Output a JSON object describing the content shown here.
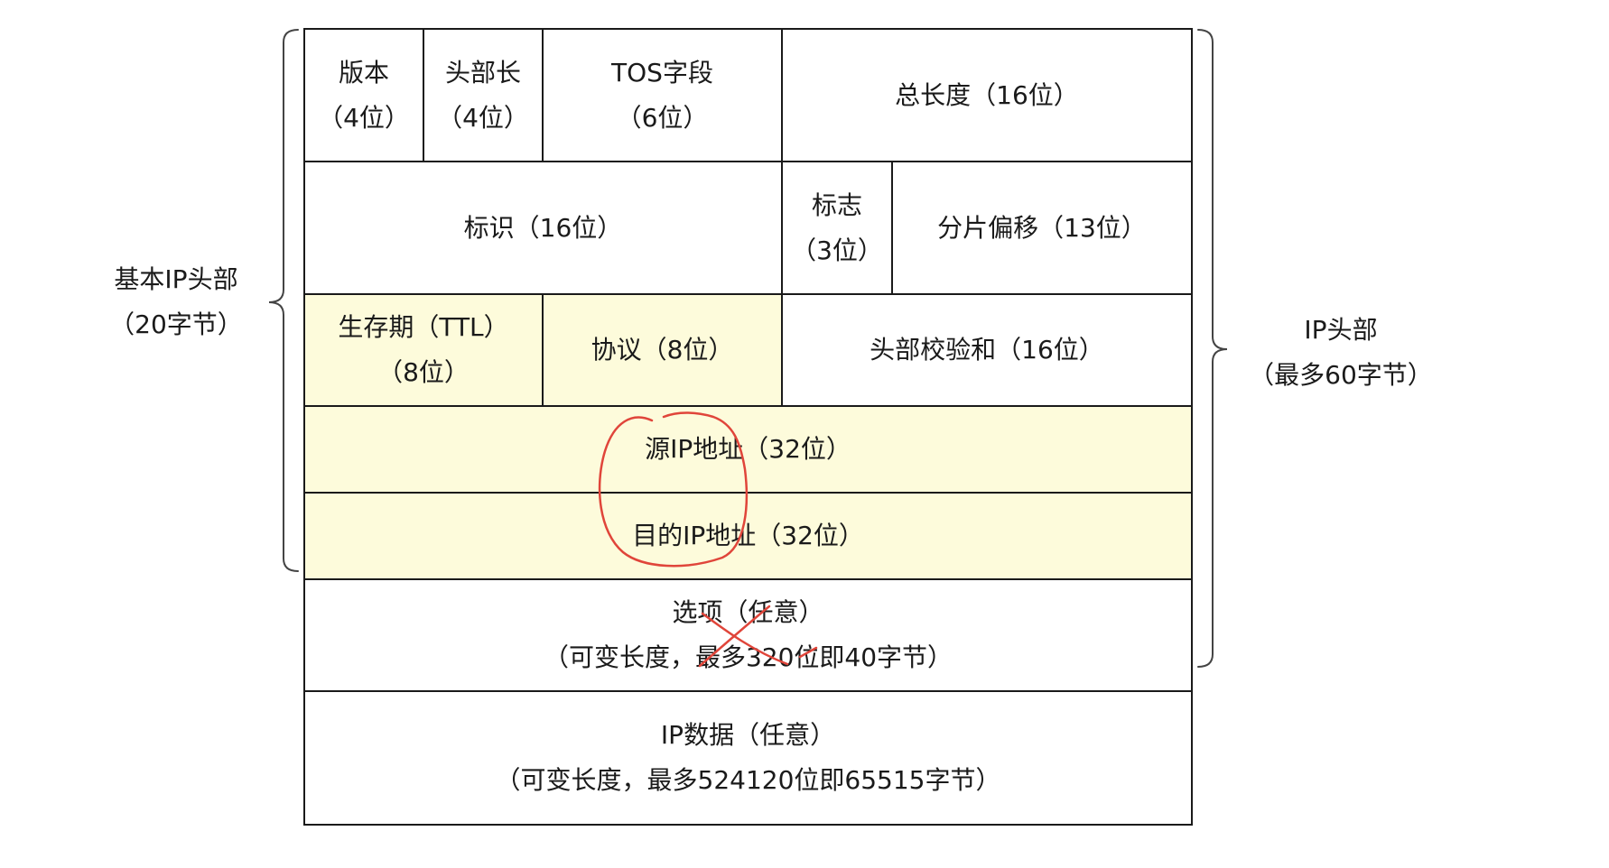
{
  "cells": {
    "version": {
      "line1": "版本",
      "line2": "（4位）"
    },
    "header_len": {
      "line1": "头部长",
      "line2": "（4位）"
    },
    "tos": {
      "line1": "TOS字段",
      "line2": "（6位）"
    },
    "total_len": {
      "line1": "总长度（16位）"
    },
    "ident": {
      "line1": "标识（16位）"
    },
    "flags": {
      "line1": "标志",
      "line2": "（3位）"
    },
    "frag_offset": {
      "line1": "分片偏移（13位）"
    },
    "ttl": {
      "line1": "生存期（TTL）",
      "line2": "（8位）"
    },
    "protocol": {
      "line1": "协议（8位）"
    },
    "checksum": {
      "line1": "头部校验和（16位）"
    },
    "src_ip": {
      "line1": "源IP地址（32位）"
    },
    "dst_ip": {
      "line1": "目的IP地址（32位）"
    },
    "options": {
      "line1": "选项（任意）",
      "line2": "（可变长度，最多320位即40字节）"
    },
    "ip_data": {
      "line1": "IP数据（任意）",
      "line2": "（可变长度，最多524120位即65515字节）"
    }
  },
  "labels": {
    "basic_header": {
      "line1": "基本IP头部",
      "line2": "（20字节）"
    },
    "ip_header": {
      "line1": "IP头部",
      "line2": "（最多60字节）"
    }
  },
  "colors": {
    "highlight_fill": "#fdfbdb",
    "border": "#1a1a1a",
    "annotation_red": "#e0453a"
  },
  "annotations": [
    {
      "type": "hand-drawn-circle",
      "around": "src_ip-and-dst_ip"
    },
    {
      "type": "hand-drawn-cross",
      "on": "options"
    }
  ]
}
